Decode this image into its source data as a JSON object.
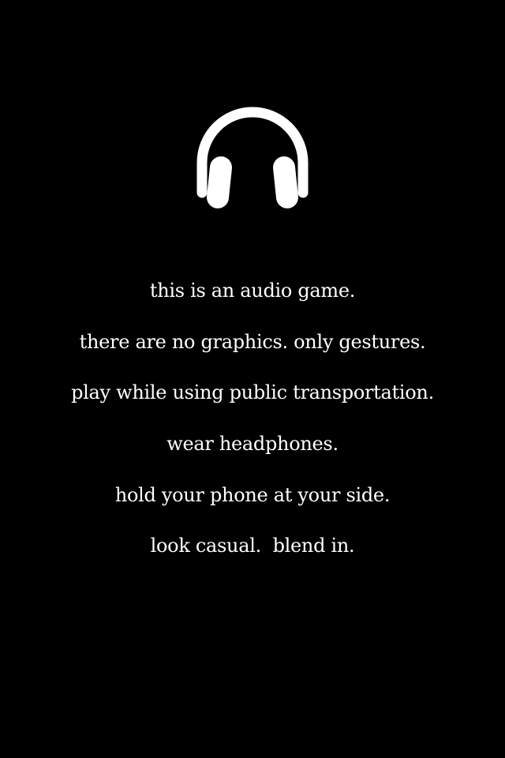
{
  "icon": {
    "name": "headphones-icon",
    "color": "#ffffff"
  },
  "colors": {
    "background": "#000000",
    "text": "#ffffff"
  },
  "instructions": [
    "this is an audio game.",
    "there are no graphics. only gestures.",
    "play while using public transportation.",
    "wear headphones.",
    "hold your phone at your side.",
    "look casual.  blend in."
  ]
}
